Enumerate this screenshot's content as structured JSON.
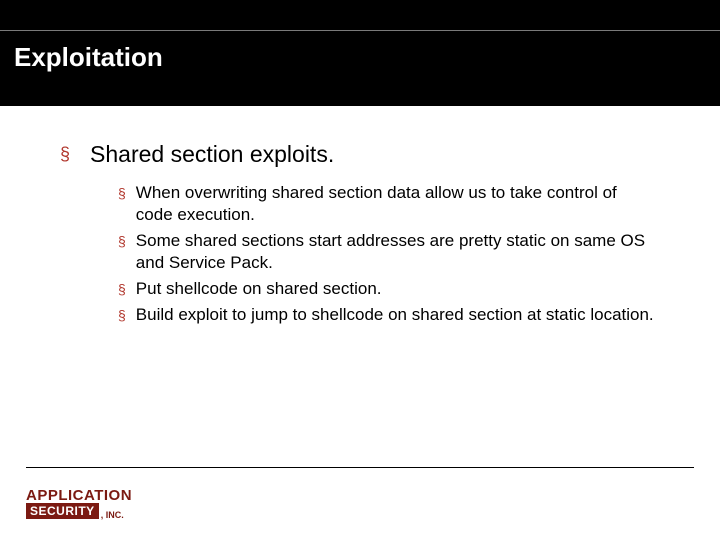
{
  "title": "Exploitation",
  "main_point": "Shared section exploits.",
  "sub_points": [
    "When overwriting shared section data allow us to take control of code execution.",
    "Some shared sections start addresses are pretty static on same OS and Service Pack.",
    "Put shellcode on shared section.",
    "Build exploit to jump to shellcode on shared section at static location."
  ],
  "logo": {
    "line1": "APPLICATION",
    "line2": "SECURITY",
    "suffix": ", INC."
  }
}
